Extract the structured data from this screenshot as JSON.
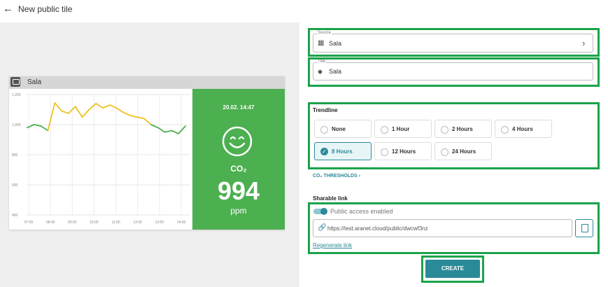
{
  "header": {
    "title": "New public tile",
    "back_icon": "arrow-left-icon"
  },
  "tile": {
    "name": "Sala",
    "time": "20.02. 14:47",
    "co2_label": "CO₂",
    "value": "994",
    "unit": "ppm",
    "status_color": "#4caf50"
  },
  "chart_data": {
    "type": "line",
    "x": [
      "07:00",
      "08:00",
      "09:00",
      "10:00",
      "11:00",
      "12:00",
      "13:00",
      "14:00"
    ],
    "y_ticks": [
      400,
      600,
      800,
      "1,000",
      "1,200"
    ],
    "ylim": [
      400,
      1200
    ],
    "series": [
      {
        "values": [
          980,
          1000,
          990,
          960,
          1145,
          1090,
          1075,
          1120,
          1050,
          1100,
          1140,
          1110,
          1130,
          1110,
          1080,
          1060,
          1050,
          1040,
          1000,
          980,
          950,
          960,
          940,
          990
        ]
      }
    ],
    "colors": {
      "above": "#f0c020",
      "below": "#4caf50"
    }
  },
  "form": {
    "source": {
      "legend": "Source",
      "value": "Sala",
      "icon": "table-icon",
      "chevron": "›"
    },
    "title": {
      "legend": "Title",
      "value": "Sala",
      "icon": "label-icon"
    },
    "trendline": {
      "label": "Trendline",
      "options": [
        "None",
        "1 Hour",
        "2 Hours",
        "4 Hours",
        "8 Hours",
        "12 Hours",
        "24 Hours"
      ],
      "selected": "8 Hours"
    },
    "co2_thresholds": "CO₂ THRESHOLDS ›",
    "sharable": {
      "label": "Sharable link",
      "toggle_label": "Public access enabled",
      "url": "https://test.aranet.cloud/public/dwcwf3nz",
      "copy_icon": "copy-icon",
      "regenerate": "Regenerate link"
    },
    "create": "CREATE"
  },
  "accent_color": "#2b8a98",
  "highlight_color": "#1aa34a"
}
